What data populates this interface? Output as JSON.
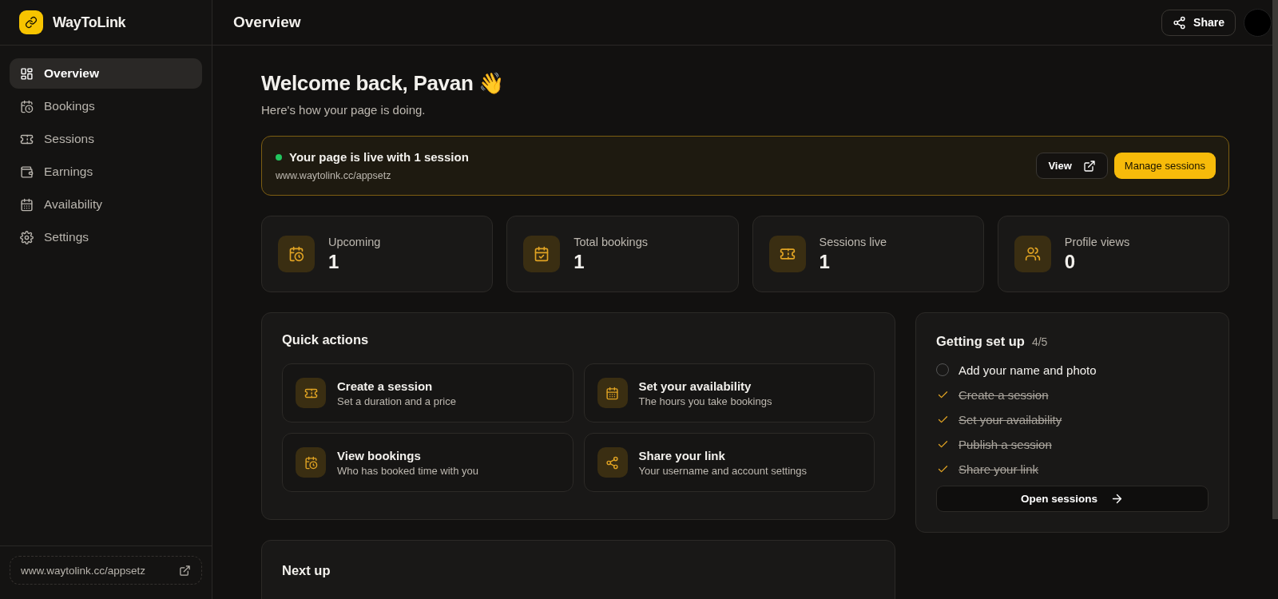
{
  "brand": {
    "name": "WayToLink"
  },
  "sidebar": {
    "items": [
      {
        "label": "Overview",
        "selected": true
      },
      {
        "label": "Bookings",
        "selected": false
      },
      {
        "label": "Sessions",
        "selected": false
      },
      {
        "label": "Earnings",
        "selected": false
      },
      {
        "label": "Availability",
        "selected": false
      },
      {
        "label": "Settings",
        "selected": false
      }
    ],
    "footer_link": "www.waytolink.cc/appsetz"
  },
  "header": {
    "title": "Overview",
    "share_button": "Share"
  },
  "welcome": {
    "title": "Welcome back, Pavan 👋",
    "subtitle": "Here's how your page is doing."
  },
  "banner": {
    "live": true,
    "title": "Your page is live with 1 session",
    "url": "www.waytolink.cc/appsetz",
    "view_button": "View",
    "manage_button": "Manage sessions"
  },
  "stats": [
    {
      "label": "Upcoming",
      "value": "1"
    },
    {
      "label": "Total bookings",
      "value": "1"
    },
    {
      "label": "Sessions live",
      "value": "1"
    },
    {
      "label": "Profile views",
      "value": "0"
    }
  ],
  "quick_actions": {
    "title": "Quick actions",
    "items": [
      {
        "title": "Create a session",
        "subtitle": "Set a duration and a price"
      },
      {
        "title": "Set your availability",
        "subtitle": "The hours you take bookings"
      },
      {
        "title": "View bookings",
        "subtitle": "Who has booked time with you"
      },
      {
        "title": "Share your link",
        "subtitle": "Your username and account settings"
      }
    ]
  },
  "setup": {
    "title": "Getting set up",
    "count": "4/5",
    "items": [
      {
        "label": "Add your name and photo",
        "done": false
      },
      {
        "label": "Create a session",
        "done": true
      },
      {
        "label": "Set your availability",
        "done": true
      },
      {
        "label": "Publish a session",
        "done": true
      },
      {
        "label": "Share your link",
        "done": true
      }
    ],
    "button": "Open sessions"
  },
  "next_up": {
    "title": "Next up"
  }
}
